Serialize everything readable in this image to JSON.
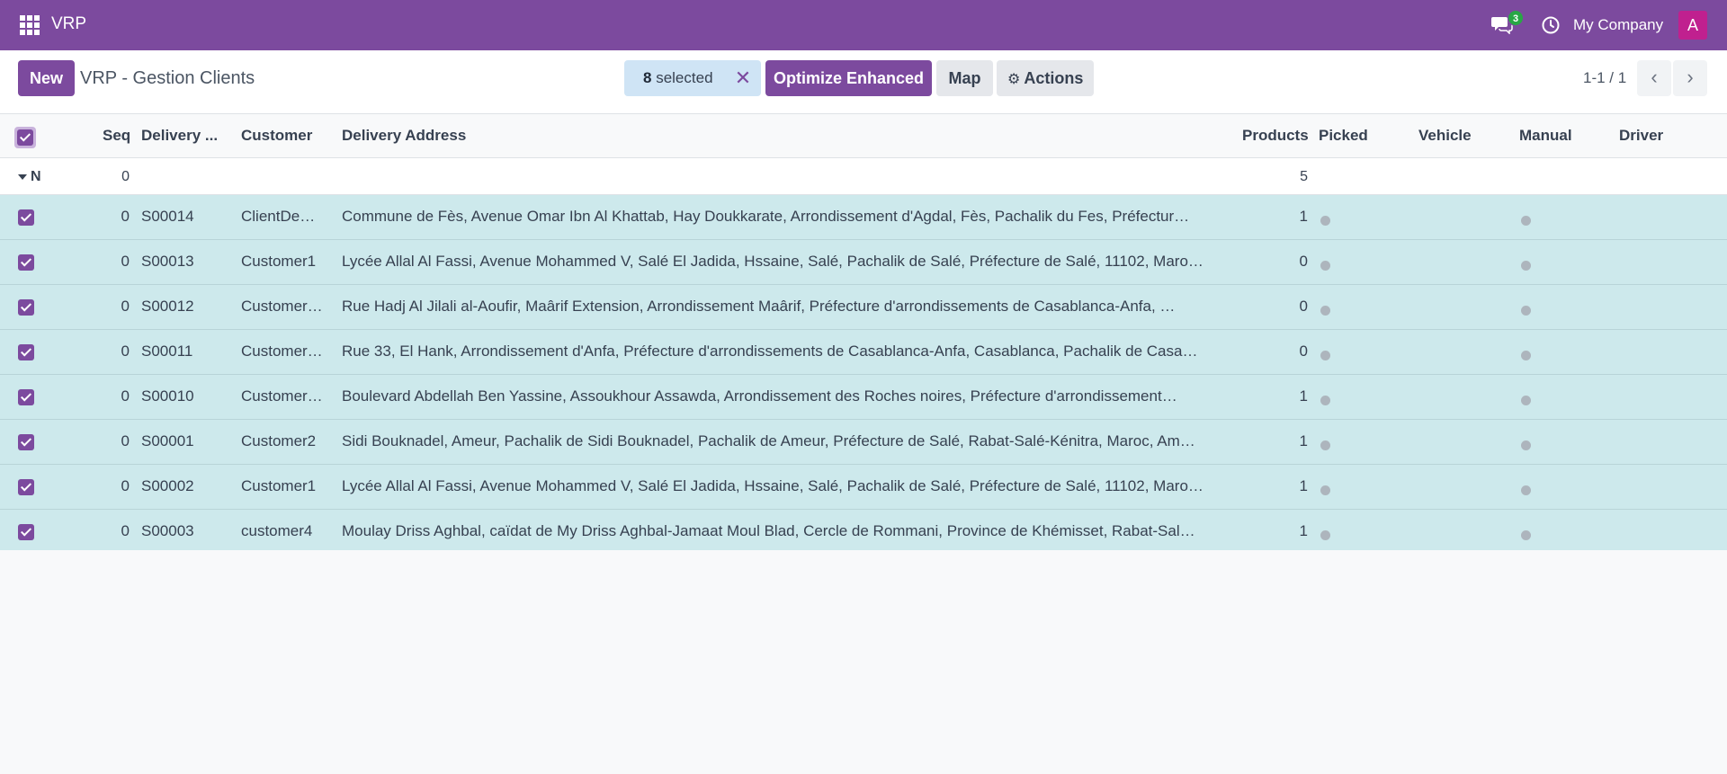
{
  "topbar": {
    "app_name": "VRP",
    "messages_count": "3",
    "company": "My Company",
    "avatar_letter": "A"
  },
  "control": {
    "new_label": "New",
    "title": "VRP - Gestion Clients",
    "selected_count": "8",
    "selected_label": "selected",
    "clear_label": "✕",
    "optimize_label": "Optimize Enhanced",
    "map_label": "Map",
    "actions_label": "Actions",
    "pager_label": "1-1 / 1"
  },
  "columns": {
    "seq": "Seq",
    "delivery": "Delivery ...",
    "customer": "Customer",
    "address": "Delivery Address",
    "products": "Products",
    "picked": "Picked",
    "vehicle": "Vehicle",
    "manual": "Manual",
    "driver": "Driver"
  },
  "group": {
    "label": "N",
    "seq_total": "0",
    "products_total": "5"
  },
  "rows": [
    {
      "seq": "0",
      "delivery": "S00014",
      "customer": "ClientDe…",
      "address": "Commune de Fès, Avenue Omar Ibn Al Khattab, Hay Doukkarate, Arrondissement d'Agdal, Fès, Pachalik du Fes, Préfectur…",
      "products": "1"
    },
    {
      "seq": "0",
      "delivery": "S00013",
      "customer": "Customer1",
      "address": "Lycée Allal Al Fassi, Avenue Mohammed V, Salé El Jadida, Hssaine, Salé, Pachalik de Salé, Préfecture de Salé, 11102, Maro…",
      "products": "0"
    },
    {
      "seq": "0",
      "delivery": "S00012",
      "customer": "Customer…",
      "address": "Rue Hadj Al Jilali al-Aoufir, Maârif Extension, Arrondissement Maârif, Préfecture d'arrondissements de Casablanca-Anfa, …",
      "products": "0"
    },
    {
      "seq": "0",
      "delivery": "S00011",
      "customer": "Customer…",
      "address": "Rue 33, El Hank, Arrondissement d'Anfa, Préfecture d'arrondissements de Casablanca-Anfa, Casablanca, Pachalik de Casa…",
      "products": "0"
    },
    {
      "seq": "0",
      "delivery": "S00010",
      "customer": "Customer…",
      "address": "Boulevard Abdellah Ben Yassine, Assoukhour Assawda, Arrondissement des Roches noires, Préfecture d'arrondissement…",
      "products": "1"
    },
    {
      "seq": "0",
      "delivery": "S00001",
      "customer": "Customer2",
      "address": "Sidi Bouknadel, Ameur, Pachalik de Sidi Bouknadel, Pachalik de Ameur, Préfecture de Salé, Rabat-Salé-Kénitra, Maroc, Am…",
      "products": "1"
    },
    {
      "seq": "0",
      "delivery": "S00002",
      "customer": "Customer1",
      "address": "Lycée Allal Al Fassi, Avenue Mohammed V, Salé El Jadida, Hssaine, Salé, Pachalik de Salé, Préfecture de Salé, 11102, Maro…",
      "products": "1"
    },
    {
      "seq": "0",
      "delivery": "S00003",
      "customer": "customer4",
      "address": "Moulay Driss Aghbal, caïdat de My Driss Aghbal-Jamaat Moul Blad, Cercle de Rommani, Province de Khémisset, Rabat-Sal…",
      "products": "1"
    }
  ]
}
